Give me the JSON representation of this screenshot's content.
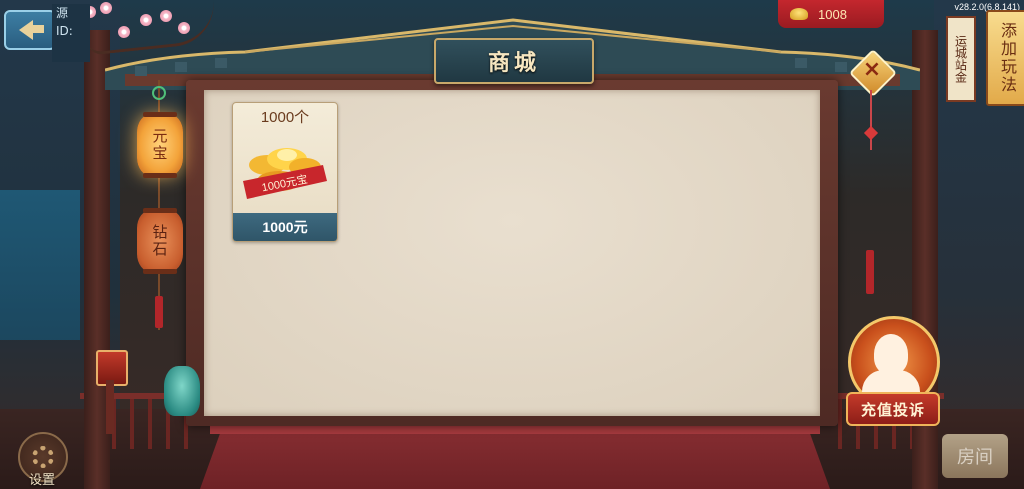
{
  "app": {
    "version": "v28.2.0(6.8.141)"
  },
  "header": {
    "title": "商城",
    "currency": {
      "icon": "gold-ingot-icon",
      "amount": "1008"
    }
  },
  "tabs": [
    {
      "label": "元宝",
      "active": true
    },
    {
      "label": "钻石",
      "active": false
    }
  ],
  "items": [
    {
      "quantity": "1000个",
      "badge": "1000元宝",
      "price": "1000元"
    }
  ],
  "side": {
    "left_partial": {
      "line1": "源",
      "line2": "ID:"
    },
    "right_sign_partial": "运城站金",
    "add_game_label": "添加玩法"
  },
  "support": {
    "label": "充值投诉"
  },
  "settings": {
    "label": "设置"
  },
  "room": {
    "label": "房间"
  },
  "colors": {
    "accent_red": "#c4272e",
    "panel_bg": "#e2d7c6",
    "price_bar": "#3e6a80",
    "gold": "#f3a33a"
  }
}
